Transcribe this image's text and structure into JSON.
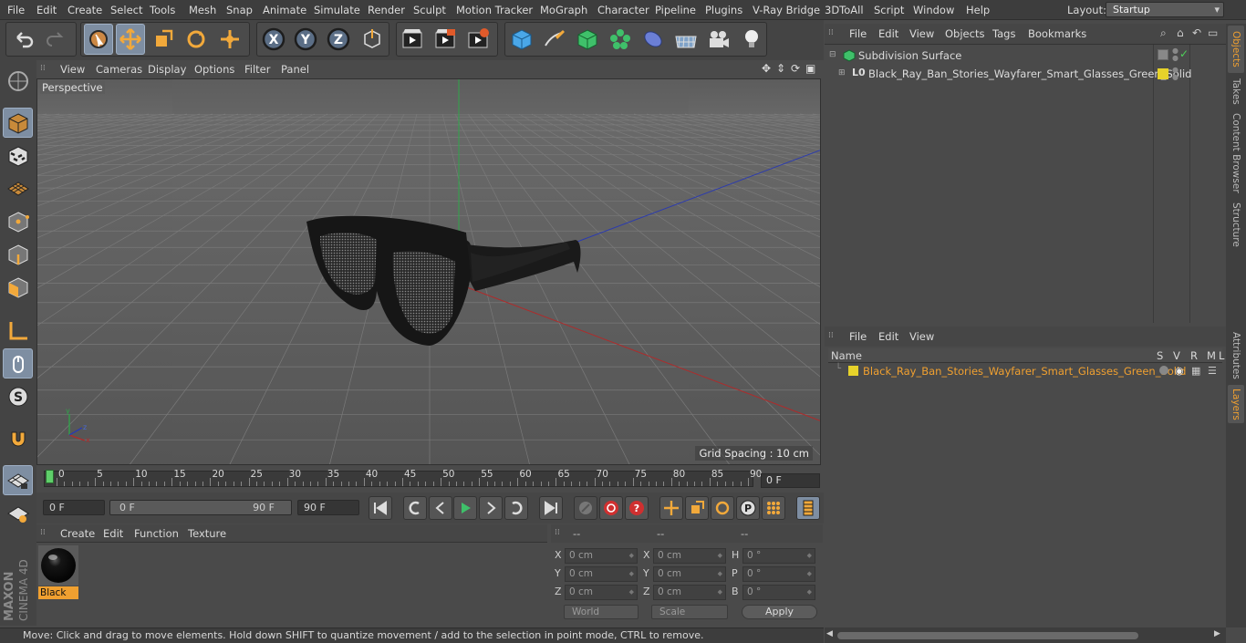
{
  "menubar": {
    "items": [
      "File",
      "Edit",
      "Create",
      "Select",
      "Tools",
      "Mesh",
      "Snap",
      "Animate",
      "Simulate",
      "Render",
      "Sculpt",
      "Motion Tracker",
      "MoGraph",
      "Character",
      "Pipeline",
      "Plugins",
      "V-Ray Bridge",
      "3DToAll",
      "Script",
      "Window",
      "Help"
    ],
    "layout_label": "Layout:",
    "layout_value": "Startup"
  },
  "viewport": {
    "menu": [
      "View",
      "Cameras",
      "Display",
      "Options",
      "Filter",
      "Panel"
    ],
    "label": "Perspective",
    "grid_spacing": "Grid Spacing : 10 cm"
  },
  "timeline": {
    "ticks": [
      "0",
      "5",
      "10",
      "15",
      "20",
      "25",
      "30",
      "35",
      "40",
      "45",
      "50",
      "55",
      "60",
      "65",
      "70",
      "75",
      "80",
      "85",
      "90"
    ],
    "current_frame": "0 F"
  },
  "transport": {
    "start": "0 F",
    "range_start": "0 F",
    "range_end": "90 F",
    "end": "90 F"
  },
  "material_manager": {
    "menu": [
      "Create",
      "Edit",
      "Function",
      "Texture"
    ],
    "materials": [
      {
        "name": "Black"
      }
    ]
  },
  "coordinates": {
    "headers": [
      "--",
      "--",
      "--"
    ],
    "rows": [
      {
        "l1": "X",
        "v1": "0 cm",
        "l2": "X",
        "v2": "0 cm",
        "l3": "H",
        "v3": "0 °"
      },
      {
        "l1": "Y",
        "v1": "0 cm",
        "l2": "Y",
        "v2": "0 cm",
        "l3": "P",
        "v3": "0 °"
      },
      {
        "l1": "Z",
        "v1": "0 cm",
        "l2": "Z",
        "v2": "0 cm",
        "l3": "B",
        "v3": "0 °"
      }
    ],
    "mode": "World",
    "scale": "Scale",
    "apply": "Apply"
  },
  "status_text": "Move: Click and drag to move elements. Hold down SHIFT to quantize movement / add to the selection in point mode, CTRL to remove.",
  "object_manager": {
    "menu": [
      "File",
      "Edit",
      "View",
      "Objects",
      "Tags",
      "Bookmarks"
    ],
    "objects": [
      {
        "name": "Subdivision Surface"
      },
      {
        "name": "Black_Ray_Ban_Stories_Wayfarer_Smart_Glasses_Green_Solid"
      }
    ]
  },
  "attributes": {
    "menu": [
      "File",
      "Edit",
      "View"
    ],
    "columns": [
      "Name",
      "S",
      "V",
      "R",
      "M",
      "L"
    ],
    "layers": [
      {
        "name": "Black_Ray_Ban_Stories_Wayfarer_Smart_Glasses_Green_Solid"
      }
    ]
  },
  "right_tabs": [
    "Objects",
    "Takes",
    "Content Browser",
    "Structure",
    "Attributes",
    "Layers"
  ],
  "brand": [
    "MAXON",
    "CINEMA 4D"
  ],
  "colors": {
    "accent": "#f0a030",
    "selected": "#7e8ea2",
    "layer_yellow": "#e6d22a"
  }
}
